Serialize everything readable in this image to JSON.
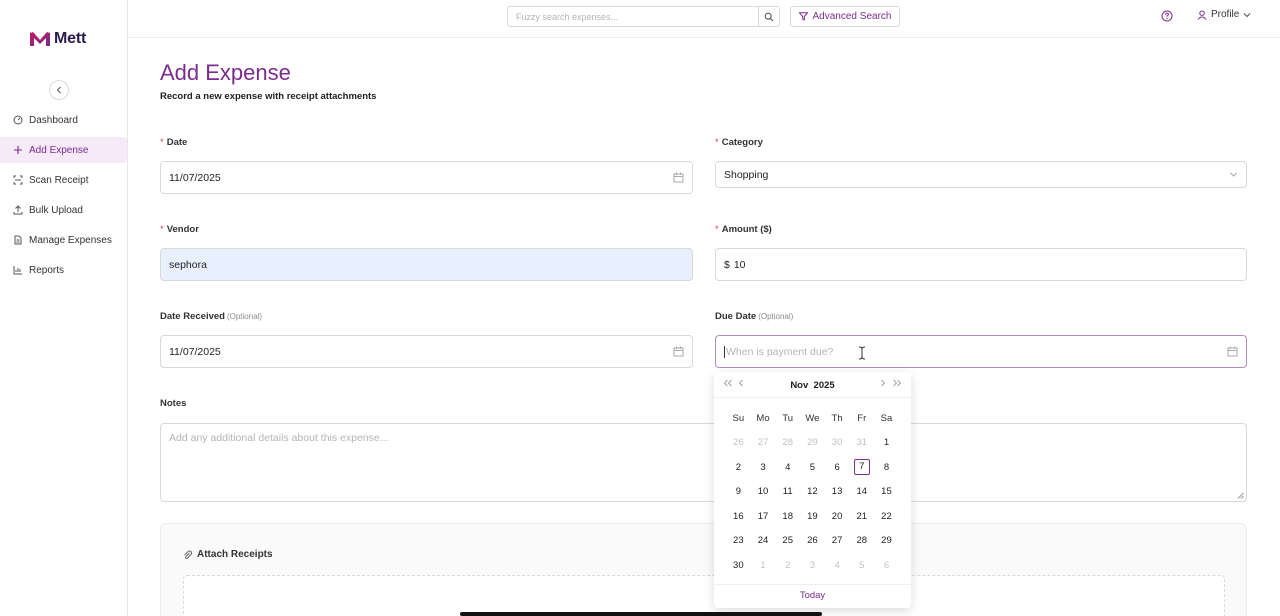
{
  "app": {
    "brand": "Mett",
    "brand_color": "#7b2d8e"
  },
  "sidebar": {
    "items": [
      {
        "label": "Dashboard",
        "icon": "dashboard-icon"
      },
      {
        "label": "Add Expense",
        "icon": "plus-icon",
        "active": true
      },
      {
        "label": "Scan Receipt",
        "icon": "scan-icon"
      },
      {
        "label": "Bulk Upload",
        "icon": "upload-icon"
      },
      {
        "label": "Manage Expenses",
        "icon": "document-icon"
      },
      {
        "label": "Reports",
        "icon": "bar-chart-icon"
      }
    ]
  },
  "topbar": {
    "search_placeholder": "Fuzzy search expenses...",
    "advanced_search": "Advanced Search",
    "profile": "Profile"
  },
  "page": {
    "title": "Add Expense",
    "subtitle": "Record a new expense with receipt attachments"
  },
  "form": {
    "date": {
      "label": "Date",
      "value": "11/07/2025"
    },
    "category": {
      "label": "Category",
      "value": "Shopping"
    },
    "vendor": {
      "label": "Vendor",
      "value": "sephora"
    },
    "amount": {
      "label": "Amount ($)",
      "prefix": "$",
      "value": "10"
    },
    "date_received": {
      "label": "Date Received",
      "optional": "(Optional)",
      "value": "11/07/2025"
    },
    "due_date": {
      "label": "Due Date",
      "optional": "(Optional)",
      "placeholder": "When is payment due?"
    },
    "notes": {
      "label": "Notes",
      "placeholder": "Add any additional details about this expense..."
    },
    "attach": {
      "label": "Attach Receipts"
    }
  },
  "calendar": {
    "month": "Nov",
    "year": "2025",
    "weekdays": [
      "Su",
      "Mo",
      "Tu",
      "We",
      "Th",
      "Fr",
      "Sa"
    ],
    "weeks": [
      [
        "26",
        "27",
        "28",
        "29",
        "30",
        "31",
        "1"
      ],
      [
        "2",
        "3",
        "4",
        "5",
        "6",
        "7",
        "8"
      ],
      [
        "9",
        "10",
        "11",
        "12",
        "13",
        "14",
        "15"
      ],
      [
        "16",
        "17",
        "18",
        "19",
        "20",
        "21",
        "22"
      ],
      [
        "23",
        "24",
        "25",
        "26",
        "27",
        "28",
        "29"
      ],
      [
        "30",
        "1",
        "2",
        "3",
        "4",
        "5",
        "6"
      ]
    ],
    "today_label": "Today",
    "today_day": "7"
  }
}
